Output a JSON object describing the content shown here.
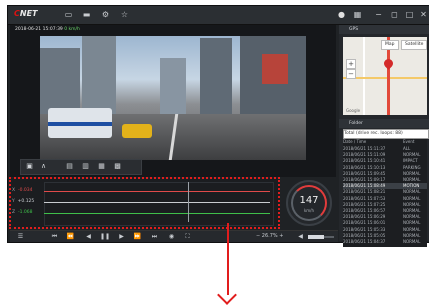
{
  "app": {
    "logo_main": "C",
    "logo_rest": "NET",
    "titlebar_icons": [
      "monitor-icon",
      "folder-icon",
      "settings-icon",
      "star-icon"
    ],
    "right_icons": [
      "location-icon",
      "grid-icon",
      "minimize-icon",
      "restore-icon",
      "maximize-icon",
      "close-icon"
    ]
  },
  "video": {
    "stamp_date": "2018-06-21 15:07:39",
    "stamp_speed": "0 km/h",
    "controls": [
      "screen-icon",
      "edit-icon",
      "view1-icon",
      "view2-icon",
      "view3-icon",
      "view4-icon"
    ]
  },
  "sensor": {
    "rows": [
      {
        "axis": "X",
        "value": "-0.034",
        "color": "#e04a4a"
      },
      {
        "axis": "Y",
        "value": "+0.125",
        "color": "#c9ccd0"
      },
      {
        "axis": "Z",
        "value": "-1.068",
        "color": "#3fbf4a"
      }
    ]
  },
  "gauge": {
    "value": "147",
    "unit": "km/h"
  },
  "playback": {
    "buttons": [
      "list-icon",
      "prev-file-icon",
      "rewind-icon",
      "step-back-icon",
      "play-icon",
      "step-forward-icon",
      "forward-icon",
      "next-file-icon",
      "capture-icon",
      "fullscreen-icon"
    ],
    "zoom_minus": "−",
    "zoom_value": "26.7%",
    "zoom_plus": "+",
    "volume": 0.62
  },
  "gps_panel": {
    "title": "GPS",
    "tab_map": "Map",
    "tab_satellite": "Satellite",
    "zoom_in": "+",
    "zoom_out": "−",
    "google": "Google"
  },
  "files_panel": {
    "title": "Folder",
    "dropdown": "Total (drive rec. loops: 88)",
    "col_date": "Date / Time",
    "col_type": "Event",
    "rows": [
      {
        "date": "2018/06/21 15:11:37",
        "type": "ALL"
      },
      {
        "date": "2018/06/21 15:11:09",
        "type": "NORMAL"
      },
      {
        "date": "2018/06/21 15:10:41",
        "type": "IMPACT"
      },
      {
        "date": "2018/06/21 15:10:13",
        "type": "PARKING"
      },
      {
        "date": "2018/06/21 15:09:45",
        "type": "NORMAL"
      },
      {
        "date": "2018/06/21 15:09:17",
        "type": "NORMAL"
      },
      {
        "date": "2018/06/21 15:08:49",
        "type": "MOTION"
      },
      {
        "date": "2018/06/21 15:08:21",
        "type": "NORMAL"
      },
      {
        "date": "2018/06/21 15:07:53",
        "type": "NORMAL"
      },
      {
        "date": "2018/06/21 15:07:25",
        "type": "NORMAL"
      },
      {
        "date": "2018/06/21 15:06:57",
        "type": "NORMAL"
      },
      {
        "date": "2018/06/21 15:06:29",
        "type": "NORMAL"
      },
      {
        "date": "2018/06/21 15:06:01",
        "type": "NORMAL"
      },
      {
        "date": "2018/06/21 15:05:33",
        "type": "NORMAL"
      },
      {
        "date": "2018/06/21 15:05:05",
        "type": "NORMAL"
      },
      {
        "date": "2018/06/21 15:04:37",
        "type": "NORMAL"
      }
    ],
    "selected_index": 6
  }
}
